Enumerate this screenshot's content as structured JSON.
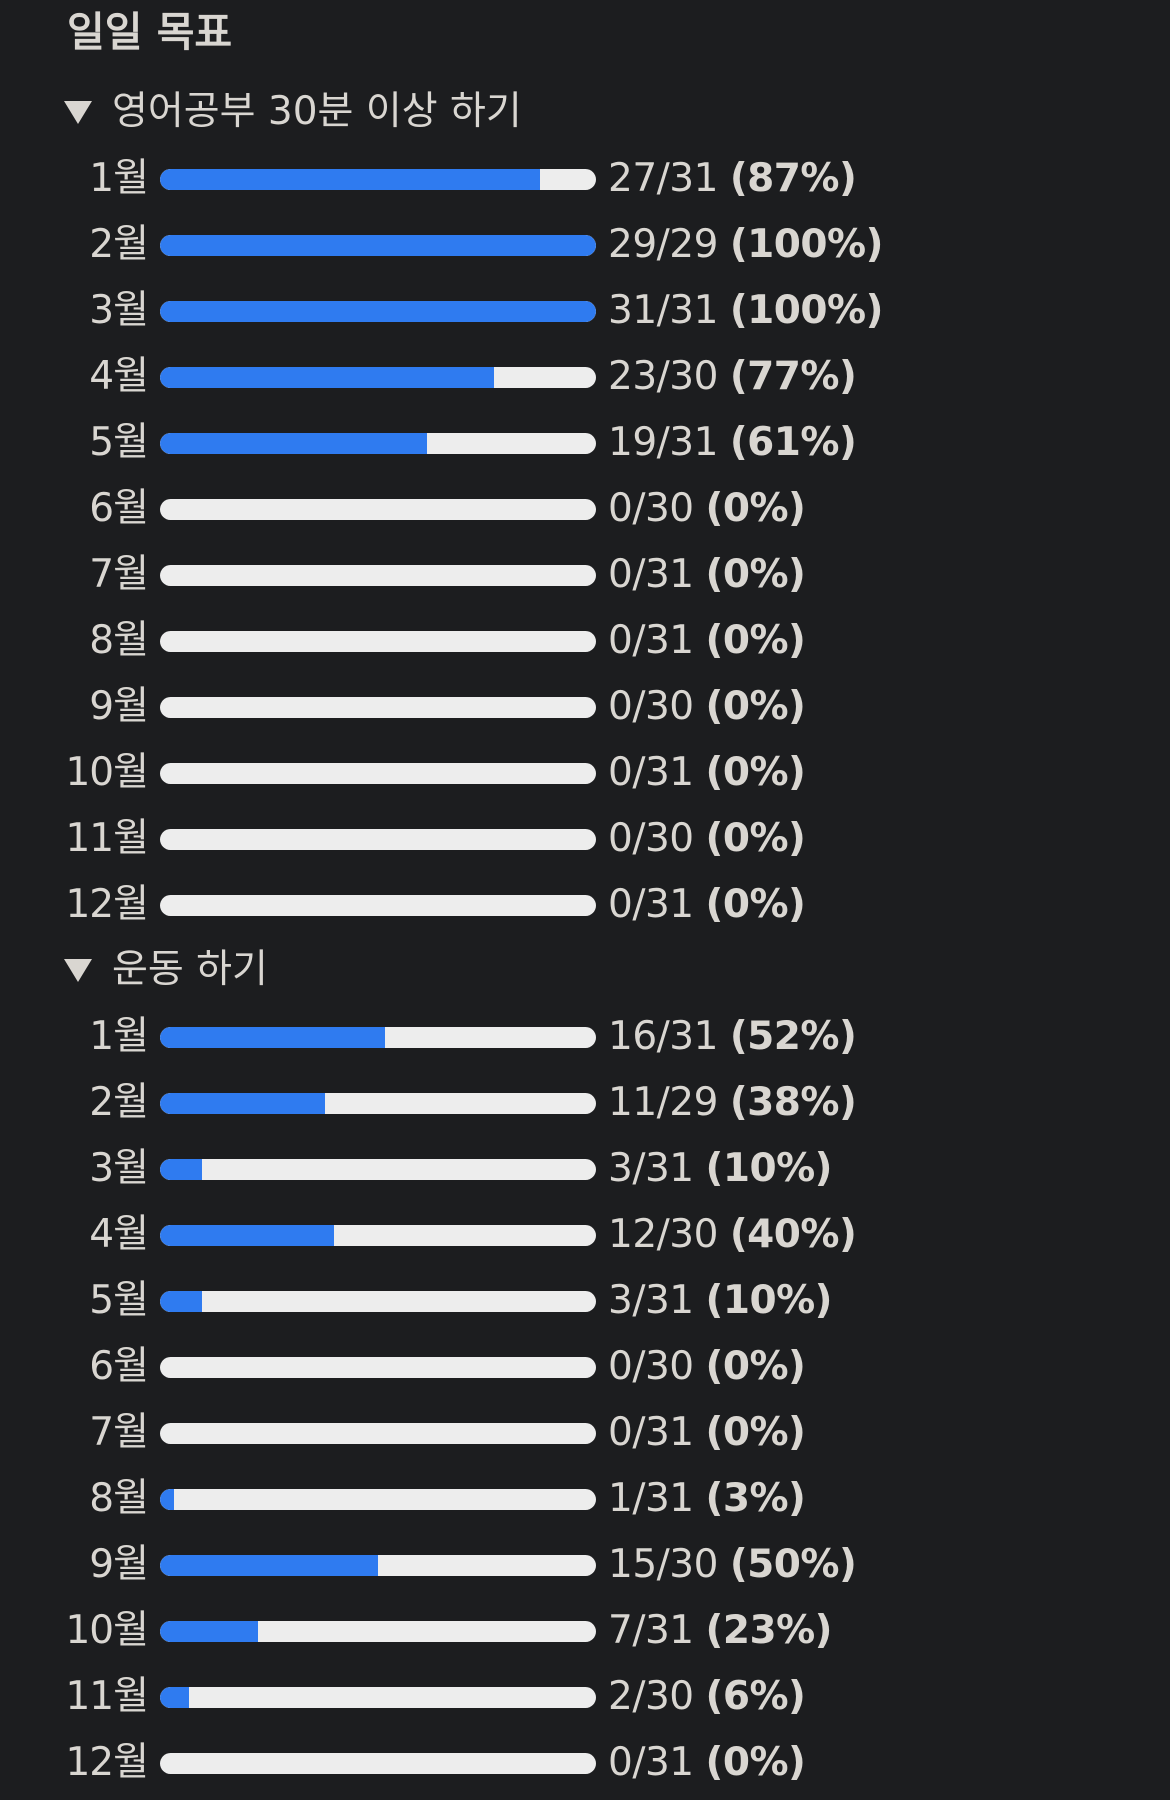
{
  "page": {
    "title": "일일 목표",
    "colors": {
      "background": "#1c1d1f",
      "text": "#d9d6d1",
      "bar_track": "#ededed",
      "bar_fill": "#2f7bf0"
    }
  },
  "sections": [
    {
      "title": "영어공부 30분 이상 하기",
      "expanded": true,
      "icon": "triangle-down-icon",
      "rows": [
        {
          "month": "1월",
          "done": 27,
          "total": 31,
          "ratio": "27/31",
          "percent": "(87%)"
        },
        {
          "month": "2월",
          "done": 29,
          "total": 29,
          "ratio": "29/29",
          "percent": "(100%)"
        },
        {
          "month": "3월",
          "done": 31,
          "total": 31,
          "ratio": "31/31",
          "percent": "(100%)"
        },
        {
          "month": "4월",
          "done": 23,
          "total": 30,
          "ratio": "23/30",
          "percent": "(77%)"
        },
        {
          "month": "5월",
          "done": 19,
          "total": 31,
          "ratio": "19/31",
          "percent": "(61%)"
        },
        {
          "month": "6월",
          "done": 0,
          "total": 30,
          "ratio": "0/30",
          "percent": "(0%)"
        },
        {
          "month": "7월",
          "done": 0,
          "total": 31,
          "ratio": "0/31",
          "percent": "(0%)"
        },
        {
          "month": "8월",
          "done": 0,
          "total": 31,
          "ratio": "0/31",
          "percent": "(0%)"
        },
        {
          "month": "9월",
          "done": 0,
          "total": 30,
          "ratio": "0/30",
          "percent": "(0%)"
        },
        {
          "month": "10월",
          "done": 0,
          "total": 31,
          "ratio": "0/31",
          "percent": "(0%)"
        },
        {
          "month": "11월",
          "done": 0,
          "total": 30,
          "ratio": "0/30",
          "percent": "(0%)"
        },
        {
          "month": "12월",
          "done": 0,
          "total": 31,
          "ratio": "0/31",
          "percent": "(0%)"
        }
      ]
    },
    {
      "title": "운동 하기",
      "expanded": true,
      "icon": "triangle-down-icon",
      "rows": [
        {
          "month": "1월",
          "done": 16,
          "total": 31,
          "ratio": "16/31",
          "percent": "(52%)"
        },
        {
          "month": "2월",
          "done": 11,
          "total": 29,
          "ratio": "11/29",
          "percent": "(38%)"
        },
        {
          "month": "3월",
          "done": 3,
          "total": 31,
          "ratio": "3/31",
          "percent": "(10%)"
        },
        {
          "month": "4월",
          "done": 12,
          "total": 30,
          "ratio": "12/30",
          "percent": "(40%)"
        },
        {
          "month": "5월",
          "done": 3,
          "total": 31,
          "ratio": "3/31",
          "percent": "(10%)"
        },
        {
          "month": "6월",
          "done": 0,
          "total": 30,
          "ratio": "0/30",
          "percent": "(0%)"
        },
        {
          "month": "7월",
          "done": 0,
          "total": 31,
          "ratio": "0/31",
          "percent": "(0%)"
        },
        {
          "month": "8월",
          "done": 1,
          "total": 31,
          "ratio": "1/31",
          "percent": "(3%)"
        },
        {
          "month": "9월",
          "done": 15,
          "total": 30,
          "ratio": "15/30",
          "percent": "(50%)"
        },
        {
          "month": "10월",
          "done": 7,
          "total": 31,
          "ratio": "7/31",
          "percent": "(23%)"
        },
        {
          "month": "11월",
          "done": 2,
          "total": 30,
          "ratio": "2/30",
          "percent": "(6%)"
        },
        {
          "month": "12월",
          "done": 0,
          "total": 31,
          "ratio": "0/31",
          "percent": "(0%)"
        }
      ]
    }
  ]
}
